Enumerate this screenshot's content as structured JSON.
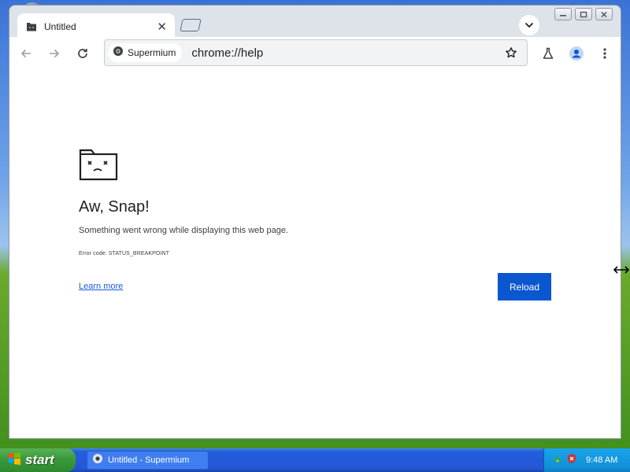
{
  "browser": {
    "tab": {
      "title": "Untitled",
      "close_glyph": "✕"
    },
    "toolbar": {
      "site_chip_label": "Supermium",
      "url": "chrome://help"
    }
  },
  "error_page": {
    "title": "Aw, Snap!",
    "message": "Something went wrong while displaying this web page.",
    "error_code": "Error code: STATUS_BREAKPOINT",
    "learn_more": "Learn more",
    "reload_label": "Reload"
  },
  "taskbar": {
    "start_label": "start",
    "task_label": "Untitled - Supermium",
    "clock": "9:48 AM"
  },
  "colors": {
    "accent": "#0b57d0",
    "link": "#1a5bd8",
    "taskbar": "#245edc",
    "start_green": "#3a9a3a"
  },
  "icons": [
    "desktop-orb-icon",
    "tab-favicon-icon",
    "new-tab-icon",
    "tab-search-icon",
    "minimize-icon",
    "maximize-icon",
    "close-window-icon",
    "back-arrow-icon",
    "forward-arrow-icon",
    "reload-icon",
    "chrome-logo-icon",
    "bookmark-star-icon",
    "labs-flask-icon",
    "profile-icon",
    "more-menu-icon",
    "sad-folder-icon",
    "resize-cursor-icon",
    "windows-logo-icon",
    "supermium-taskbar-icon",
    "security-shield-icon",
    "network-icon"
  ]
}
